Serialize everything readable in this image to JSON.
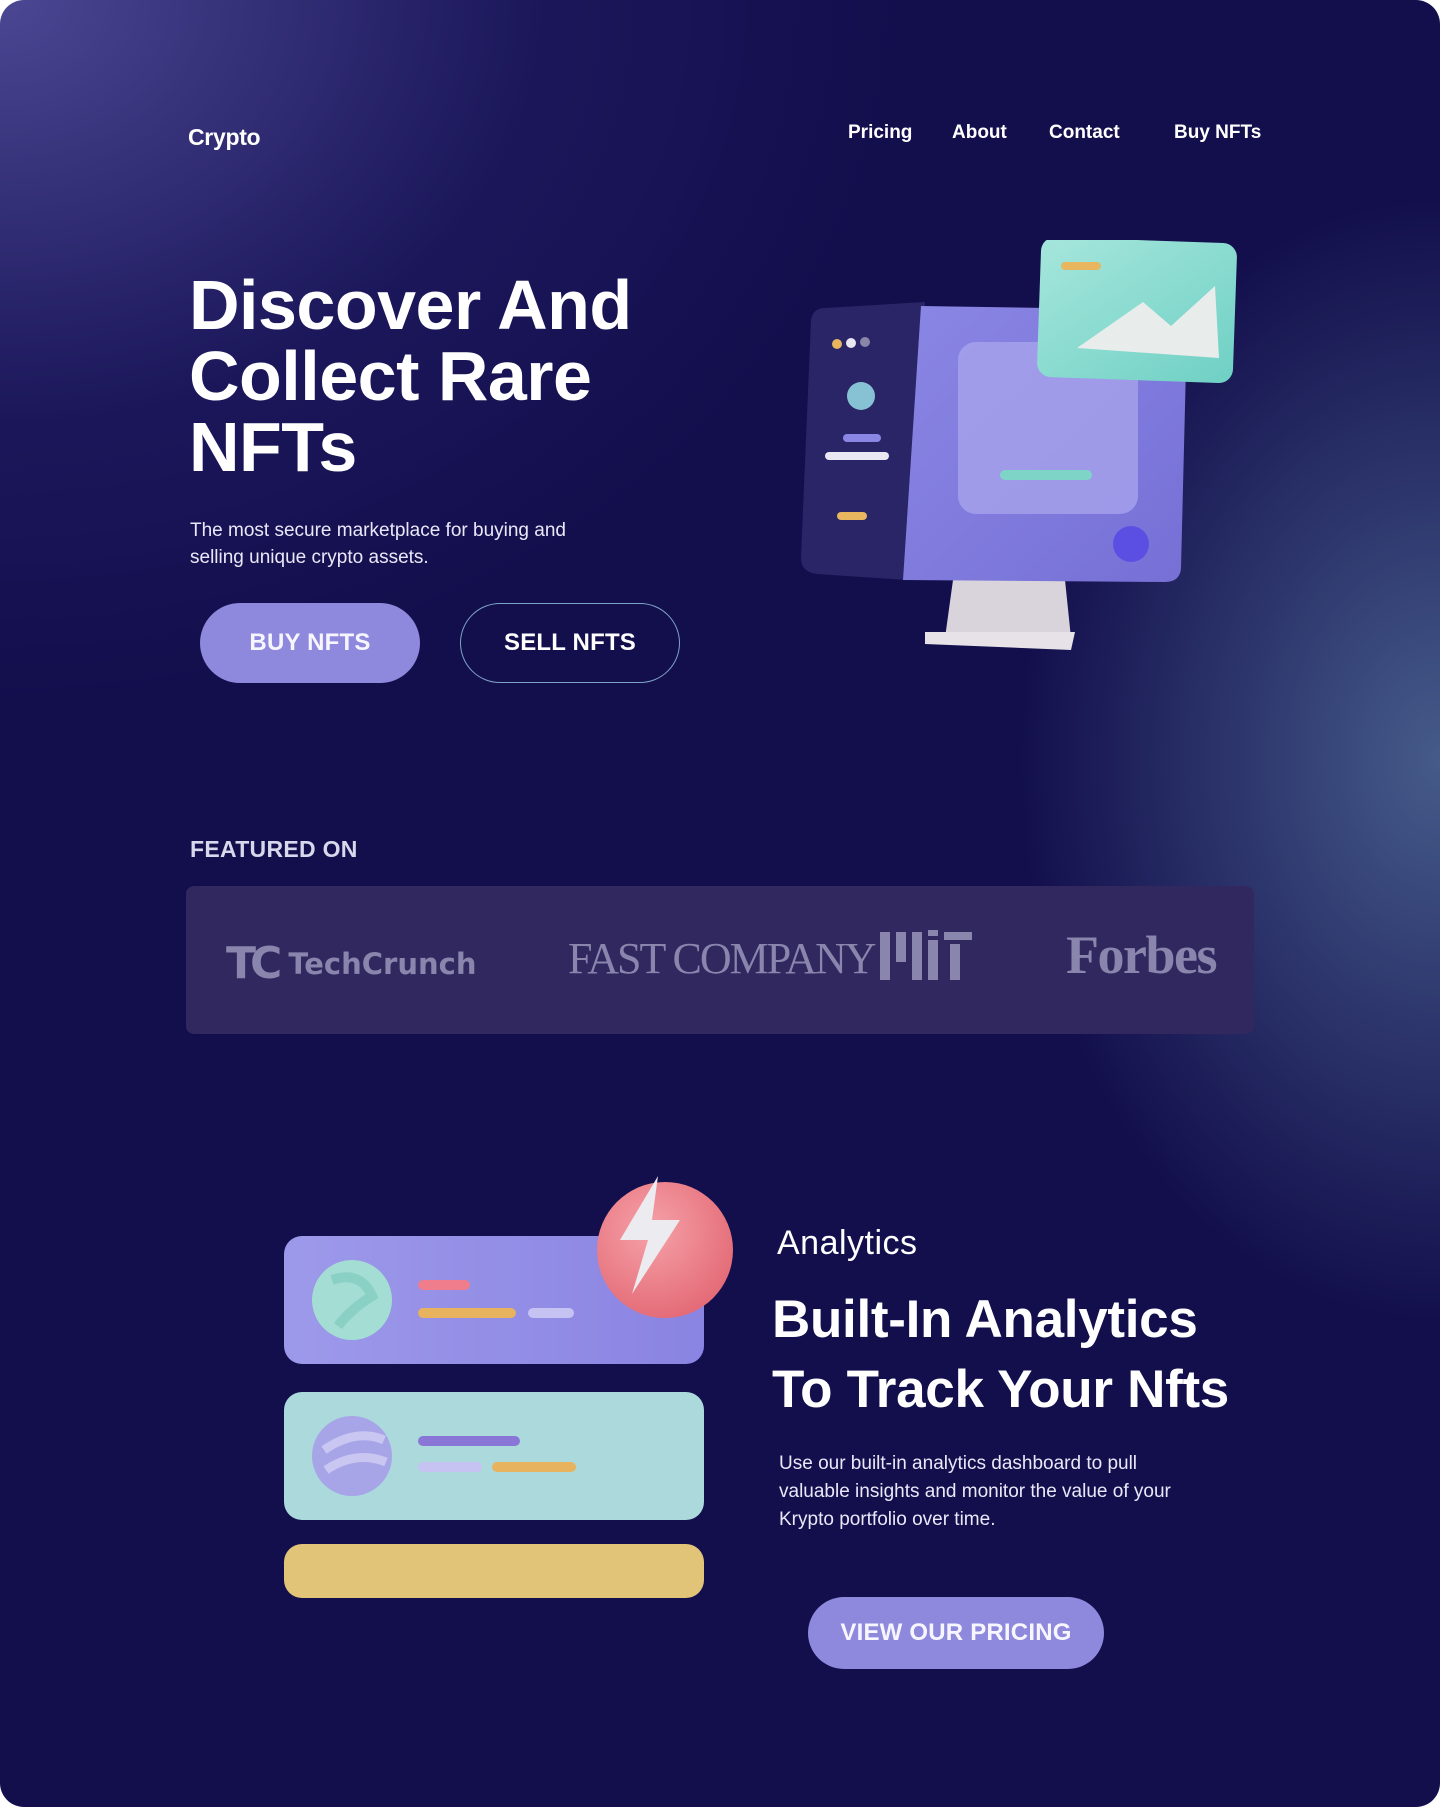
{
  "brand": {
    "name": "Crypto"
  },
  "nav": {
    "items": [
      {
        "label": "Pricing"
      },
      {
        "label": "About"
      },
      {
        "label": "Contact"
      },
      {
        "label": "Buy NFTs"
      }
    ]
  },
  "hero": {
    "title_lines": [
      "Discover And",
      "Collect Rare",
      "NFTs"
    ],
    "subtitle": "The most secure marketplace for buying and selling unique crypto assets.",
    "primary_button": "BUY NFTS",
    "secondary_button": "SELL NFTS"
  },
  "featured": {
    "label": "FEATURED ON",
    "logos": [
      {
        "name": "TechCrunch",
        "mark": "TC",
        "text": "TechCrunch"
      },
      {
        "name": "Fast Company",
        "text": "FAST COMPANY"
      },
      {
        "name": "MIT",
        "text": "MIT"
      },
      {
        "name": "Forbes",
        "text": "Forbes"
      }
    ]
  },
  "analytics": {
    "eyebrow": "Analytics",
    "title_lines": [
      "Built-In Analytics",
      "To Track Your Nfts"
    ],
    "body": "Use our built-in analytics dashboard to pull valuable insights and monitor the value of your Krypto portfolio over time.",
    "button": "VIEW OUR PRICING"
  },
  "colors": {
    "background": "#130f4d",
    "accent_button": "#8e89dc",
    "logo_strip": "#30285f",
    "outline_button_border": "#7fa3c8"
  }
}
